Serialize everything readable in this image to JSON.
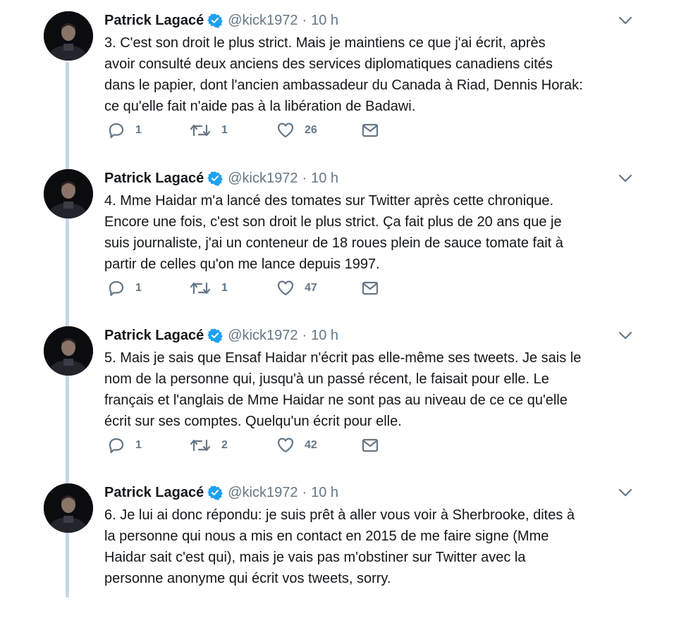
{
  "tweets": [
    {
      "author": "Patrick Lagacé",
      "handle": "@kick1972",
      "separator": "·",
      "time": "10 h",
      "lines": [
        "3. C'est son droit le plus strict. Mais je maintiens ce que j'ai écrit, après",
        "avoir consulté deux anciens des services diplomatiques canadiens cités",
        "dans le papier, dont l'ancien ambassadeur du Canada à Riad, Dennis Horak:",
        "ce qu'elle fait n'aide pas à la libération de Badawi."
      ],
      "replies": "1",
      "retweets": "1",
      "likes": "26"
    },
    {
      "author": "Patrick Lagacé",
      "handle": "@kick1972",
      "separator": "·",
      "time": "10 h",
      "lines": [
        "4. Mme Haidar m'a lancé des tomates sur Twitter après cette chronique.",
        "Encore une fois, c'est son droit le plus strict. Ça fait plus de 20 ans que je",
        "suis journaliste, j'ai un conteneur de 18 roues plein de sauce tomate fait à",
        "partir de celles qu'on me lance depuis 1997."
      ],
      "replies": "1",
      "retweets": "1",
      "likes": "47"
    },
    {
      "author": "Patrick Lagacé",
      "handle": "@kick1972",
      "separator": "·",
      "time": "10 h",
      "lines": [
        "5. Mais je sais que Ensaf Haidar n'écrit pas elle-même ses tweets. Je sais le",
        "nom de la personne qui, jusqu'à un passé récent, le faisait pour elle. Le",
        "français et l'anglais de Mme Haidar ne sont pas au niveau de ce ce qu'elle",
        "écrit sur ses comptes. Quelqu'un écrit pour elle."
      ],
      "replies": "1",
      "retweets": "2",
      "likes": "42"
    },
    {
      "author": "Patrick Lagacé",
      "handle": "@kick1972",
      "separator": "·",
      "time": "10 h",
      "lines": [
        "6. Je lui ai donc répondu: je suis prêt à aller vous voir à Sherbrooke, dites à",
        "la personne qui nous a mis en contact en 2015 de me faire signe (Mme",
        "Haidar sait c'est qui), mais je vais pas m'obstiner sur Twitter avec la",
        "personne anonyme qui écrit vos tweets, sorry."
      ]
    }
  ],
  "colors": {
    "verified": "#1da1f2",
    "thread_line": "#c4d7ea",
    "secondary_text": "#657786",
    "icon": "#657786"
  },
  "icons": [
    "verified-badge-icon",
    "chevron-down-icon",
    "reply-icon",
    "retweet-icon",
    "like-icon",
    "direct-message-icon"
  ]
}
